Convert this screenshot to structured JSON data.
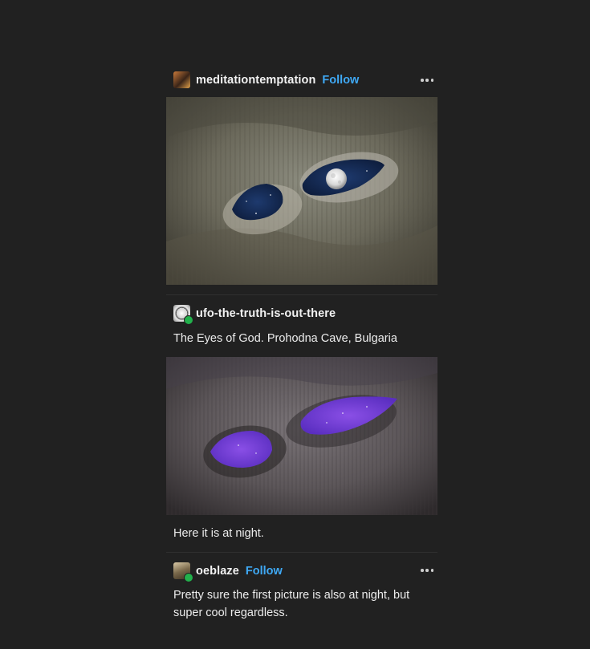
{
  "posts": [
    {
      "username": "meditationtemptation",
      "follow_label": "Follow",
      "image_alt": "cave with two openings showing night sky and moon",
      "more_icon": "more-horizontal-icon"
    },
    {
      "username": "ufo-the-truth-is-out-there",
      "caption": "The Eyes of God. Prohodna Cave, Bulgaria",
      "image_alt": "cave openings with purple starry night sky",
      "followup": "Here it is at night."
    },
    {
      "username": "oeblaze",
      "follow_label": "Follow",
      "comment": "Pretty sure the first picture is also at night, but super cool regardless.",
      "more_icon": "more-horizontal-icon"
    }
  ],
  "colors": {
    "background": "#212121",
    "accent": "#3fa9f5",
    "reblog_badge": "#22b14c"
  }
}
